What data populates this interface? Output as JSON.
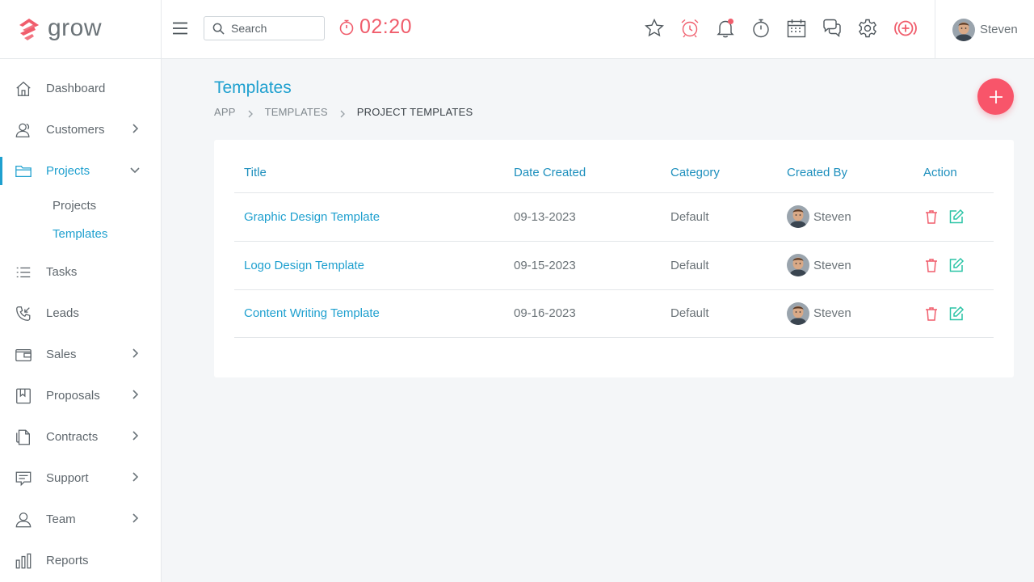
{
  "app": {
    "logo_text": "grow"
  },
  "colors": {
    "accent": "#1fa0cf",
    "danger": "#f05d6c",
    "success": "#2cc4a6"
  },
  "sidebar": {
    "items": [
      {
        "label": "Dashboard",
        "icon": "home-icon"
      },
      {
        "label": "Customers",
        "icon": "users-icon"
      },
      {
        "label": "Projects",
        "icon": "folder-icon",
        "expanded": true,
        "children": [
          {
            "label": "Projects"
          },
          {
            "label": "Templates",
            "active": true
          }
        ]
      },
      {
        "label": "Tasks",
        "icon": "list-icon"
      },
      {
        "label": "Leads",
        "icon": "phone-icon"
      },
      {
        "label": "Sales",
        "icon": "wallet-icon"
      },
      {
        "label": "Proposals",
        "icon": "bookmark-icon"
      },
      {
        "label": "Contracts",
        "icon": "document-icon"
      },
      {
        "label": "Support",
        "icon": "chat-icon"
      },
      {
        "label": "Team",
        "icon": "user-icon"
      },
      {
        "label": "Reports",
        "icon": "bar-chart-icon"
      }
    ]
  },
  "topbar": {
    "search_placeholder": "Search",
    "timer": "02:20",
    "icons": [
      "star-icon",
      "alarm-clock-icon",
      "bell-icon",
      "stopwatch-icon",
      "calendar-icon",
      "chat-bubbles-icon",
      "gear-icon",
      "add-circle-icon"
    ],
    "user_name": "Steven"
  },
  "page": {
    "title": "Templates",
    "breadcrumb": [
      "APP",
      "TEMPLATES",
      "PROJECT TEMPLATES"
    ]
  },
  "table": {
    "columns": [
      "Title",
      "Date Created",
      "Category",
      "Created By",
      "Action"
    ],
    "rows": [
      {
        "title": "Graphic Design Template",
        "date": "09-13-2023",
        "category": "Default",
        "created_by": "Steven"
      },
      {
        "title": "Logo Design Template",
        "date": "09-15-2023",
        "category": "Default",
        "created_by": "Steven"
      },
      {
        "title": "Content Writing Template",
        "date": "09-16-2023",
        "category": "Default",
        "created_by": "Steven"
      }
    ]
  }
}
